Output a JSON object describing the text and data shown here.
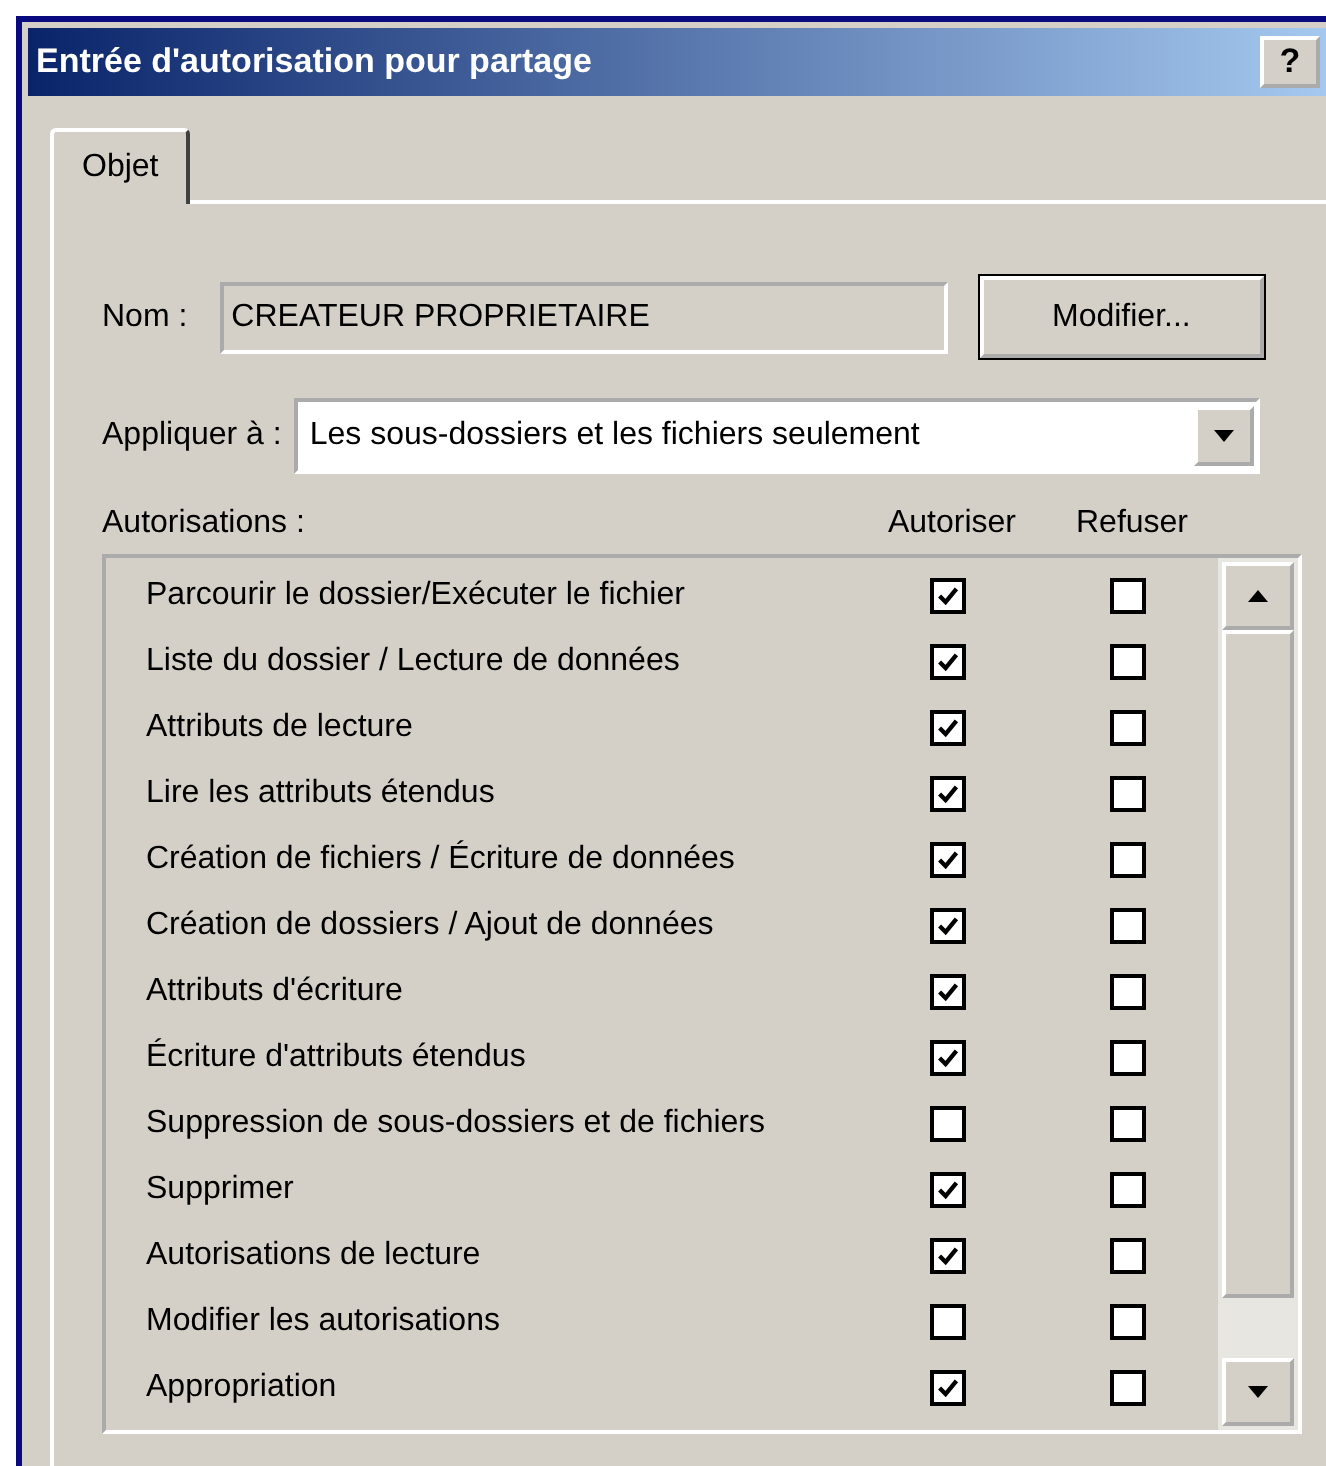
{
  "window": {
    "title": "Entrée d'autorisation pour partage",
    "help_button": "?"
  },
  "tabs": [
    {
      "label": "Objet",
      "selected": true
    }
  ],
  "name_field": {
    "label": "Nom :",
    "value": "CREATEUR PROPRIETAIRE"
  },
  "modify_button": "Modifier...",
  "apply_to": {
    "label": "Appliquer à :",
    "value": "Les sous-dossiers et les fichiers seulement"
  },
  "permissions": {
    "label": "Autorisations :",
    "columns": [
      "Autoriser",
      "Refuser"
    ],
    "rows": [
      {
        "name": "Parcourir le dossier/Exécuter le fichier",
        "allow": true,
        "deny": false
      },
      {
        "name": "Liste du dossier / Lecture de données",
        "allow": true,
        "deny": false
      },
      {
        "name": "Attributs de lecture",
        "allow": true,
        "deny": false
      },
      {
        "name": "Lire les attributs étendus",
        "allow": true,
        "deny": false
      },
      {
        "name": "Création de fichiers / Écriture de données",
        "allow": true,
        "deny": false
      },
      {
        "name": "Création de dossiers / Ajout de données",
        "allow": true,
        "deny": false
      },
      {
        "name": "Attributs d'écriture",
        "allow": true,
        "deny": false
      },
      {
        "name": "Écriture d'attributs étendus",
        "allow": true,
        "deny": false
      },
      {
        "name": "Suppression de sous-dossiers et de fichiers",
        "allow": false,
        "deny": false
      },
      {
        "name": "Supprimer",
        "allow": true,
        "deny": false
      },
      {
        "name": "Autorisations de lecture",
        "allow": true,
        "deny": false
      },
      {
        "name": "Modifier les autorisations",
        "allow": false,
        "deny": false
      },
      {
        "name": "Appropriation",
        "allow": true,
        "deny": false
      }
    ]
  }
}
